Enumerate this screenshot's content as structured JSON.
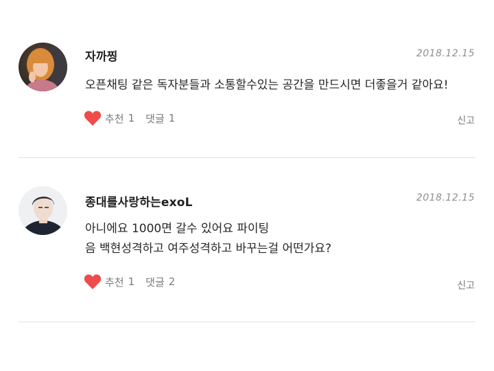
{
  "colors": {
    "heart": "#ef4b4b",
    "divider": "#e2e2e2",
    "meta_text": "#8e8e8e"
  },
  "comments": [
    {
      "author": "자까찡",
      "date": "2018.12.15",
      "lines": [
        "오픈채팅 같은 독자분들과 소통할수있는 공간을 만드시면 더좋을거 같아요!"
      ],
      "like_label": "추천",
      "like_count": "1",
      "reply_label": "댓글",
      "reply_count": "1",
      "report_label": "신고",
      "avatar_icon": "user-avatar-photo"
    },
    {
      "author": "종대를사랑하는exoL",
      "date": "2018.12.15",
      "lines": [
        "아니에요 1000면 갈수 있어요 파이팅",
        "음 백현성격하고 여주성격하고 바꾸는걸 어떤가요?"
      ],
      "like_label": "추천",
      "like_count": "1",
      "reply_label": "댓글",
      "reply_count": "2",
      "report_label": "신고",
      "avatar_icon": "user-avatar-photo"
    }
  ]
}
